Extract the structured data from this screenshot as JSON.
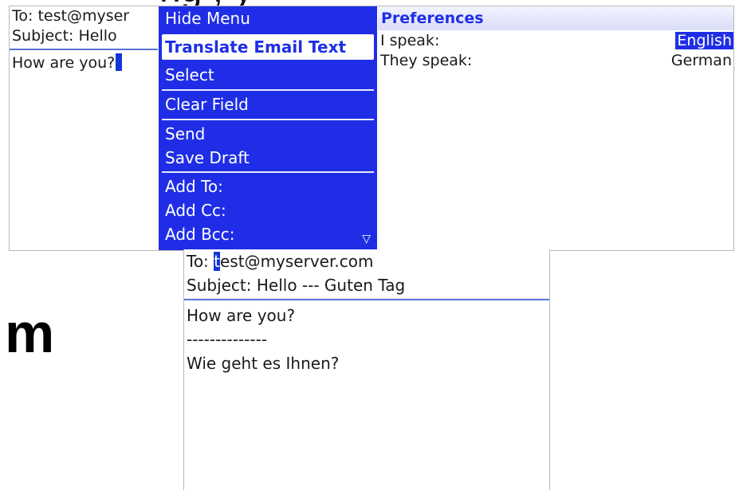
{
  "slide": {
    "top_text": "ng         ,         y",
    "letter": "m"
  },
  "screen1": {
    "compose": {
      "to_label": "To:",
      "to_value": "test@myser",
      "subject_label": "Subject:",
      "subject_value": "Hello",
      "body": "How are you?"
    },
    "menu": {
      "items": [
        {
          "label": "Hide Menu"
        },
        {
          "label": "Translate Email Text"
        },
        {
          "label": "Select"
        },
        {
          "label": "Clear Field"
        },
        {
          "label": "Send"
        },
        {
          "label": "Save Draft"
        },
        {
          "label": "Add To:"
        },
        {
          "label": "Add Cc:"
        },
        {
          "label": "Add Bcc:"
        }
      ],
      "scroll_indicator": "▽"
    },
    "preferences": {
      "title": "Preferences",
      "i_speak_label": "I speak:",
      "i_speak_value": "English",
      "they_speak_label": "They speak:",
      "they_speak_value": "German"
    }
  },
  "screen2": {
    "to_label": "To:",
    "to_first_char": "t",
    "to_rest": "est@myserver.com",
    "subject_label": "Subject:",
    "subject_value": "Hello --- Guten Tag",
    "body_original": "How are you?",
    "body_separator": "--------------",
    "body_translated": "Wie geht es Ihnen?"
  },
  "colors": {
    "menu_blue": "#1f2ee6",
    "selection_blue": "#1336d8",
    "separator_blue": "#5a73d6"
  }
}
